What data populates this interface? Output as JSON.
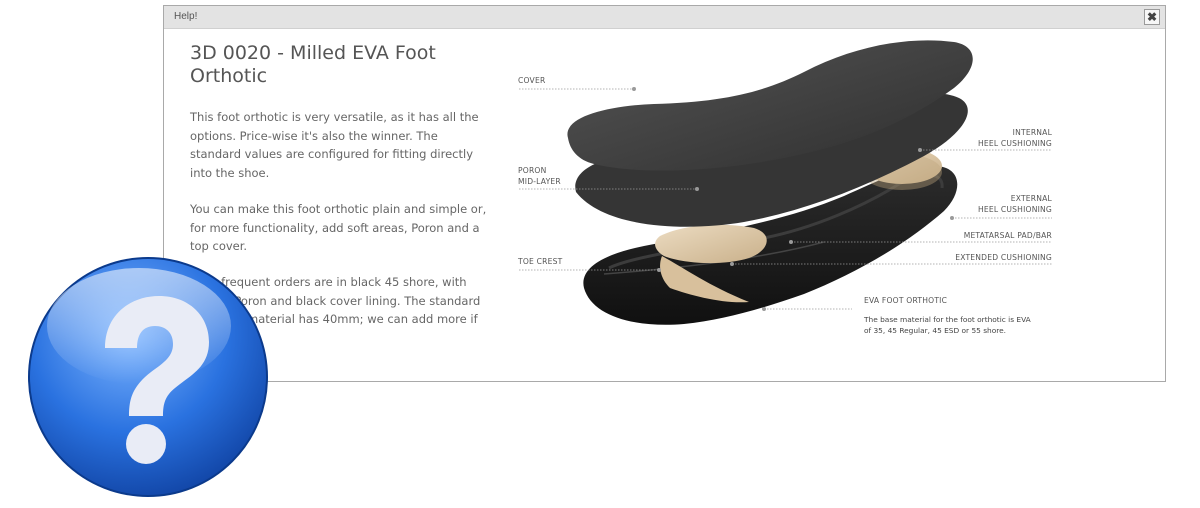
{
  "dialog": {
    "title": "Help!",
    "close_glyph": "✖",
    "heading": "3D 0020 - Milled EVA Foot Orthotic",
    "paragraphs": [
      "This foot orthotic is very versatile, as it has all the options. Price-wise it's also the winner. The standard values are configured for fitting directly into the shoe.",
      "You can make this foot orthotic plain and simple or, for more functionality, add soft areas, Poron and a top cover.",
      "Most frequent orders are in black 45 shore, with 1,5mm Poron and black cover lining. The standard EVA base material has 40mm; we can add more if needed."
    ]
  },
  "diagram": {
    "labels": {
      "cover": "COVER",
      "poron_1": "PORON",
      "poron_2": "MID-LAYER",
      "toe_crest": "TOE CREST",
      "internal_1": "INTERNAL",
      "internal_2": "HEEL CUSHIONING",
      "external_1": "EXTERNAL",
      "external_2": "HEEL CUSHIONING",
      "metatarsal": "METATARSAL PAD/BAR",
      "extended": "EXTENDED CUSHIONING",
      "eva": "EVA FOOT ORTHOTIC",
      "eva_caption_1": "The base material for the foot orthotic is EVA",
      "eva_caption_2": "of 35, 45 Regular, 45 ESD or 55 shore."
    },
    "colors": {
      "layer_dark": "#3a3a3a",
      "base_black": "#1c1c1c",
      "cushion_tan": "#d9c3a1"
    }
  },
  "help_icon": {
    "name": "question-mark-icon",
    "color": "#2a6fd6",
    "glyph": "?"
  }
}
